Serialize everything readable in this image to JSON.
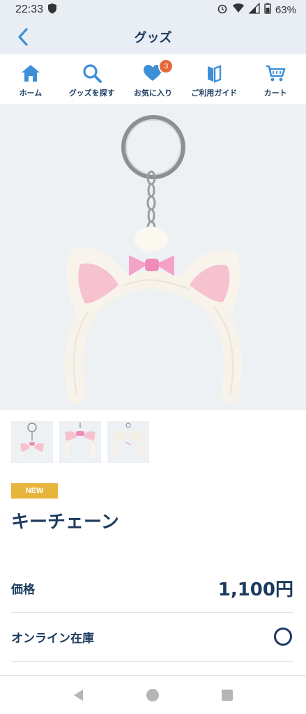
{
  "status_bar": {
    "time": "22:33",
    "battery": "63%"
  },
  "header": {
    "title": "グッズ",
    "back_icon": "chevron-left-icon"
  },
  "nav": {
    "items": [
      {
        "label": "ホーム",
        "icon": "home-icon"
      },
      {
        "label": "グッズを探す",
        "icon": "search-icon"
      },
      {
        "label": "お気に入り",
        "icon": "heart-icon",
        "badge": "3"
      },
      {
        "label": "ご利用ガイド",
        "icon": "guide-book-icon"
      },
      {
        "label": "カート",
        "icon": "cart-icon"
      }
    ]
  },
  "product": {
    "badge": "NEW",
    "name": "キーチェーン",
    "price_label": "価格",
    "price": "1,100円",
    "stock_label": "オンライン在庫",
    "stock_status_icon": "circle-available-icon"
  },
  "colors": {
    "accent": "#3d8fd8",
    "navy": "#1c3a5e",
    "badge_new": "#e8b53c",
    "badge_count": "#e8673a"
  }
}
